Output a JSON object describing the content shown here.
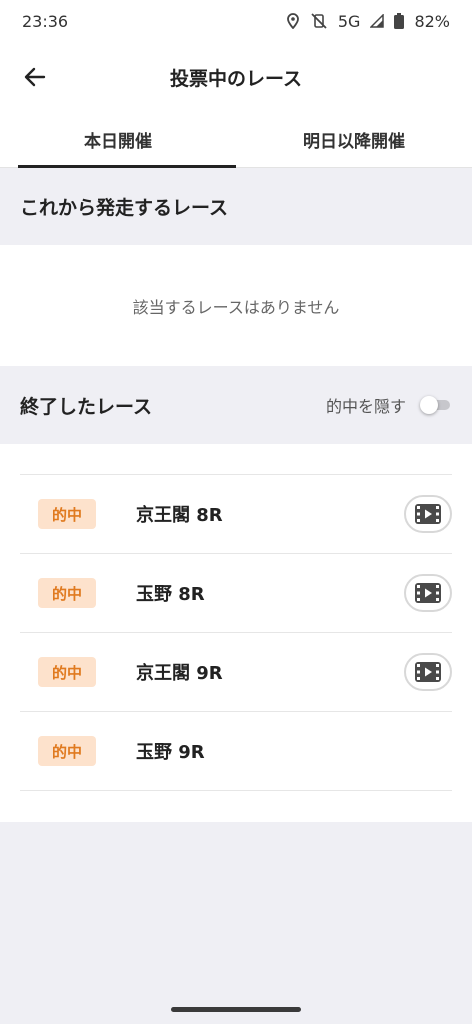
{
  "status_bar": {
    "time": "23:36",
    "network": "5G",
    "battery": "82%",
    "icons": [
      "location-icon",
      "vibrate-off-icon",
      "signal-icon",
      "battery-icon"
    ]
  },
  "header": {
    "title": "投票中のレース",
    "back_icon": "arrow-left-icon"
  },
  "tabs": [
    {
      "label": "本日開催",
      "active": true
    },
    {
      "label": "明日以降開催",
      "active": false
    }
  ],
  "upcoming": {
    "title": "これから発走するレース",
    "empty_message": "該当するレースはありません"
  },
  "finished": {
    "title": "終了したレース",
    "hide_hits_label": "的中を隠す",
    "hide_hits_on": false,
    "races": [
      {
        "badge": "的中",
        "name": "京王閣 8R",
        "has_video": true
      },
      {
        "badge": "的中",
        "name": "玉野 8R",
        "has_video": true
      },
      {
        "badge": "的中",
        "name": "京王閣 9R",
        "has_video": true
      },
      {
        "badge": "的中",
        "name": "玉野 9R",
        "has_video": false
      }
    ]
  },
  "colors": {
    "badge_bg": "#fde2cc",
    "badge_text": "#e07a1f",
    "background": "#efeff4"
  }
}
